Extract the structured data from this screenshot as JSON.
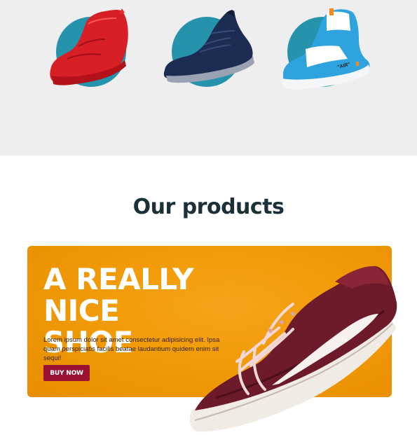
{
  "section": {
    "title": "Our products"
  },
  "thumbnails": [
    {
      "name": "red high-top sneaker"
    },
    {
      "name": "navy knit running shoe"
    },
    {
      "name": "blue and white high-top sneaker",
      "tag": "\"AIR\""
    }
  ],
  "promo": {
    "headline_line1": "A REALLY NICE",
    "headline_line2": "SHOE",
    "body": "Lorem ipsum dolor sit amet consectetur adipisicing elit. Ipsa quam perspiciatis facilis beatae laudantium quidem enim sit sequi!",
    "button_label": "BUY NOW"
  },
  "colors": {
    "top_background": "#eeeeee",
    "circle_accent": "#2693ad",
    "title_text": "#1b3039",
    "card_orange": "#f19b08",
    "button_crimson": "#9b1233"
  }
}
